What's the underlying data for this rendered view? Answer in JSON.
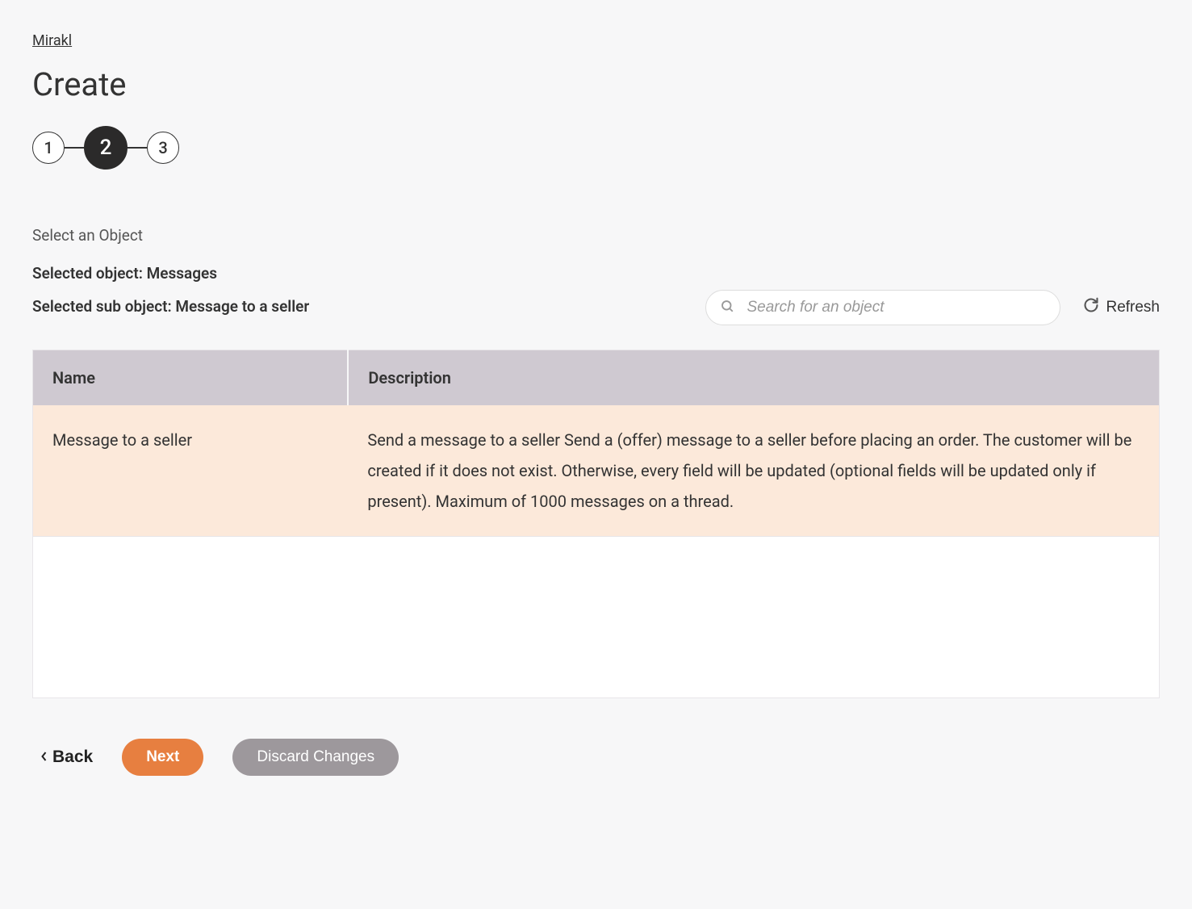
{
  "breadcrumb": {
    "link_label": "Mirakl"
  },
  "page_title": "Create",
  "stepper": {
    "steps": [
      "1",
      "2",
      "3"
    ],
    "active_index": 1
  },
  "section": {
    "select_label": "Select an Object",
    "selected_object_label": "Selected object: Messages",
    "selected_sub_object_label": "Selected sub object: Message to a seller"
  },
  "search": {
    "placeholder": "Search for an object"
  },
  "refresh_label": "Refresh",
  "table": {
    "headers": {
      "name": "Name",
      "description": "Description"
    },
    "rows": [
      {
        "name": "Message to a seller",
        "description": "Send a message to a seller Send a (offer) message to a seller before placing an order. The customer will be created if it does not exist. Otherwise, every field will be updated (optional fields will be updated only if present). Maximum of 1000 messages on a thread.",
        "selected": true
      }
    ]
  },
  "footer": {
    "back_label": "Back",
    "next_label": "Next",
    "discard_label": "Discard Changes"
  }
}
